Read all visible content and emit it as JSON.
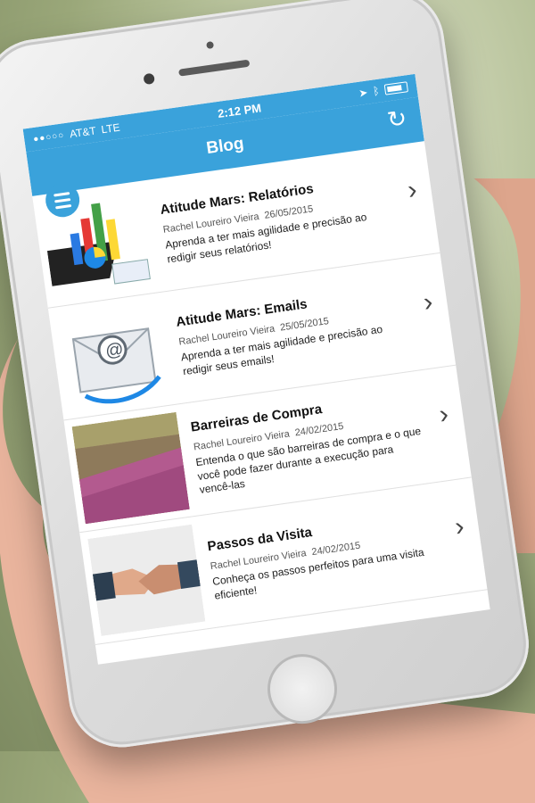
{
  "status": {
    "carrier": "AT&T",
    "network": "LTE",
    "time": "2:12 PM"
  },
  "header": {
    "title": "Blog"
  },
  "posts": [
    {
      "title": "Atitude Mars: Relatórios",
      "author": "Rachel Loureiro Vieira",
      "date": "26/05/2015",
      "excerpt": "Aprenda a ter mais agilidade e precisão ao redigir seus relatórios!"
    },
    {
      "title": "Atitude Mars: Emails",
      "author": "Rachel Loureiro Vieira",
      "date": "25/05/2015",
      "excerpt": "Aprenda a ter mais agilidade e precisão ao redigir seus emails!"
    },
    {
      "title": "Barreiras de Compra",
      "author": "Rachel Loureiro Vieira",
      "date": "24/02/2015",
      "excerpt": "Entenda o que são barreiras de compra e o que você pode fazer durante a execução para vencê-las"
    },
    {
      "title": "Passos da Visita",
      "author": "Rachel Loureiro Vieira",
      "date": "24/02/2015",
      "excerpt": "Conheça os passos perfeitos para uma visita eficiente!"
    }
  ],
  "colors": {
    "accent": "#3aa2db"
  }
}
